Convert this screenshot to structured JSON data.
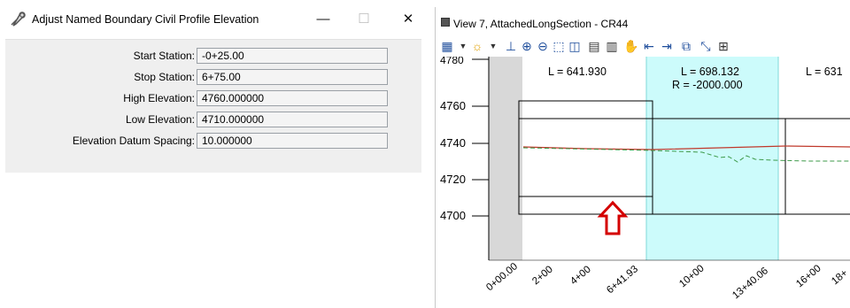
{
  "dialog": {
    "title": "Adjust Named Boundary Civil Profile Elevation",
    "minimize": "—",
    "maximize": "☐",
    "close": "✕",
    "fields": [
      {
        "label": "Start Station:",
        "value": "-0+25.00"
      },
      {
        "label": "Stop Station:",
        "value": "6+75.00"
      },
      {
        "label": "High Elevation:",
        "value": "4760.000000"
      },
      {
        "label": "Low Elevation:",
        "value": "4710.000000"
      },
      {
        "label": "Elevation Datum Spacing:",
        "value": "10.000000"
      }
    ]
  },
  "view": {
    "title": "View 7, AttachedLongSection - CR44",
    "segments": [
      {
        "length": "L = 641.930"
      },
      {
        "length": "L = 698.132",
        "radius": "R = -2000.000"
      },
      {
        "length": "L = 631"
      }
    ],
    "elevation_ticks": [
      "4760",
      "4740",
      "4720",
      "4700"
    ],
    "top_partial_tick": "4780",
    "station_ticks": [
      "0+00.00",
      "2+00",
      "4+00",
      "6+41.93",
      "10+00",
      "13+40.06",
      "16+00",
      "18+"
    ],
    "colors": {
      "highlight": "#ccfbfb",
      "gray_band": "#d8d8d8",
      "profile_red": "#c0392b",
      "profile_green": "#3d9a4a",
      "arrow": "#d40000"
    }
  }
}
